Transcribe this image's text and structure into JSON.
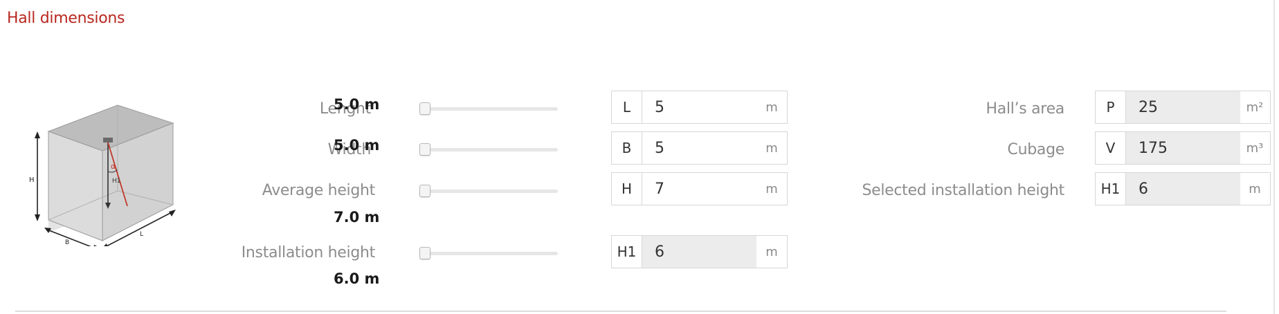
{
  "section": {
    "title": "Hall dimensions"
  },
  "diagram": {
    "labels": {
      "h": "H",
      "h1": "H1",
      "alpha": "α",
      "b": "B",
      "l": "L"
    }
  },
  "sliders": [
    {
      "label": "Lenght",
      "value_display": "5.0 m",
      "level": 0
    },
    {
      "label": "Width",
      "value_display": "5.0 m",
      "level": 0
    },
    {
      "label": "Average height",
      "value_display": "7.0 m",
      "level": 0
    },
    {
      "label": "Installation height",
      "value_display": "6.0 m",
      "level": 0
    }
  ],
  "inputs": [
    {
      "prefix": "L",
      "value": "5",
      "unit": "m",
      "readonly": false
    },
    {
      "prefix": "B",
      "value": "5",
      "unit": "m",
      "readonly": false
    },
    {
      "prefix": "H",
      "value": "7",
      "unit": "m",
      "readonly": false
    },
    {
      "prefix": "H1",
      "value": "6",
      "unit": "m",
      "readonly": true
    }
  ],
  "results": [
    {
      "label": "Hall’s area",
      "prefix": "P",
      "value": "25",
      "unit": "m²"
    },
    {
      "label": "Cubage",
      "prefix": "V",
      "value": "175",
      "unit": "m³"
    },
    {
      "label": "Selected installation height",
      "prefix": "H1",
      "value": "6",
      "unit": "m"
    }
  ],
  "colors": {
    "accent": "#b8281f",
    "label_gray": "#8c8c8c",
    "readonly_bg": "#ececec"
  }
}
